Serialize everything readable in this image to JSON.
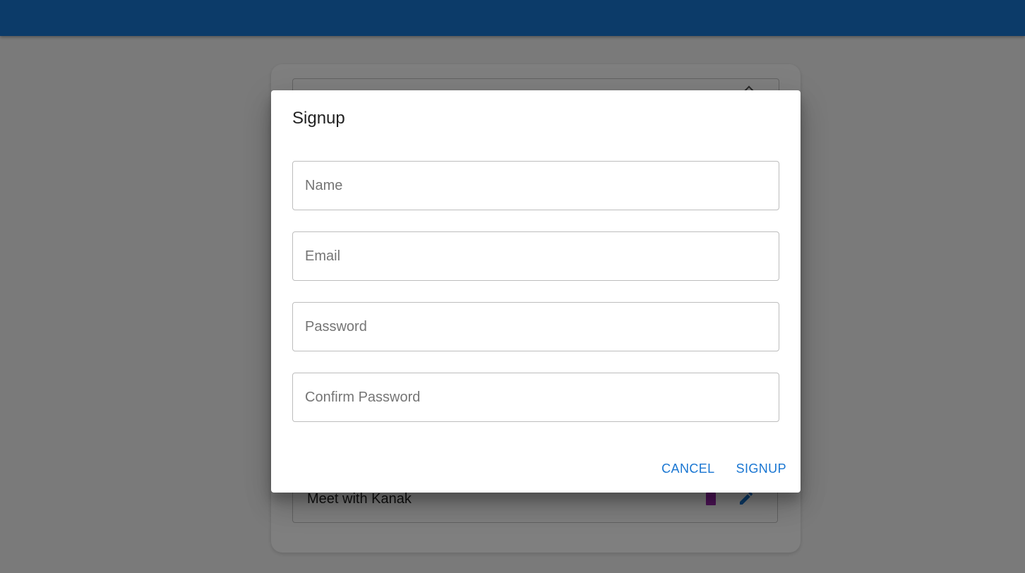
{
  "dialog": {
    "title": "Signup",
    "fields": [
      {
        "placeholder": "Name",
        "value": ""
      },
      {
        "placeholder": "Email",
        "value": ""
      },
      {
        "placeholder": "Password",
        "value": ""
      },
      {
        "placeholder": "Confirm Password",
        "value": ""
      }
    ],
    "cancel_label": "CANCEL",
    "submit_label": "SIGNUP"
  },
  "background": {
    "todo_text": "Meet with Kanak"
  },
  "colors": {
    "app_bar": "#1976d2",
    "accent": "#1976d2",
    "trash": "#9c27b0"
  },
  "icons": {
    "trash": "trash-icon",
    "edit": "edit-icon"
  }
}
